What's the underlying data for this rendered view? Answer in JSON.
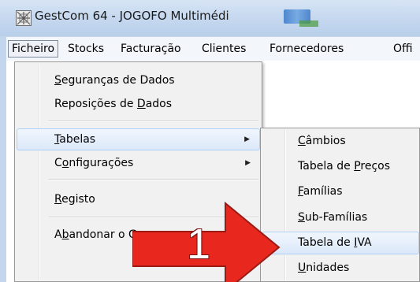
{
  "window": {
    "title": "GestCom 64 - JOGOFO Multimédi"
  },
  "menubar": {
    "items": [
      {
        "label": "Ficheiro"
      },
      {
        "label": "Stocks"
      },
      {
        "label": "Facturação"
      },
      {
        "label": "Clientes"
      },
      {
        "label": "Fornecedores"
      },
      {
        "label": "Offi"
      }
    ]
  },
  "ficheiro_menu": {
    "items": [
      {
        "pre": "",
        "key": "S",
        "post": "eguranças de Dados"
      },
      {
        "pre": "Reposições de ",
        "key": "D",
        "post": "ados"
      },
      {
        "pre": "",
        "key": "T",
        "post": "abelas",
        "submenu": true
      },
      {
        "pre": "C",
        "key": "o",
        "post": "nfigurações",
        "submenu": true
      },
      {
        "pre": "",
        "key": "R",
        "post": "egisto"
      },
      {
        "pre": "A",
        "key": "b",
        "post": "andonar o Ge"
      }
    ]
  },
  "tabelas_submenu": {
    "items": [
      {
        "pre": "",
        "key": "C",
        "post": "âmbios"
      },
      {
        "pre": "Tabela de ",
        "key": "P",
        "post": "reços"
      },
      {
        "pre": "",
        "key": "F",
        "post": "amílias"
      },
      {
        "pre": "",
        "key": "S",
        "post": "ub-Famílias"
      },
      {
        "pre": "Tabela de ",
        "key": "I",
        "post": "VA"
      },
      {
        "pre": "",
        "key": "U",
        "post": "nidades"
      }
    ]
  },
  "callout": {
    "number": "1",
    "color": "#e8281e"
  },
  "colors": {
    "highlight_border": "#aecff7",
    "menu_bg": "#f1f1f1",
    "titlebar": "#c3d6ee"
  }
}
